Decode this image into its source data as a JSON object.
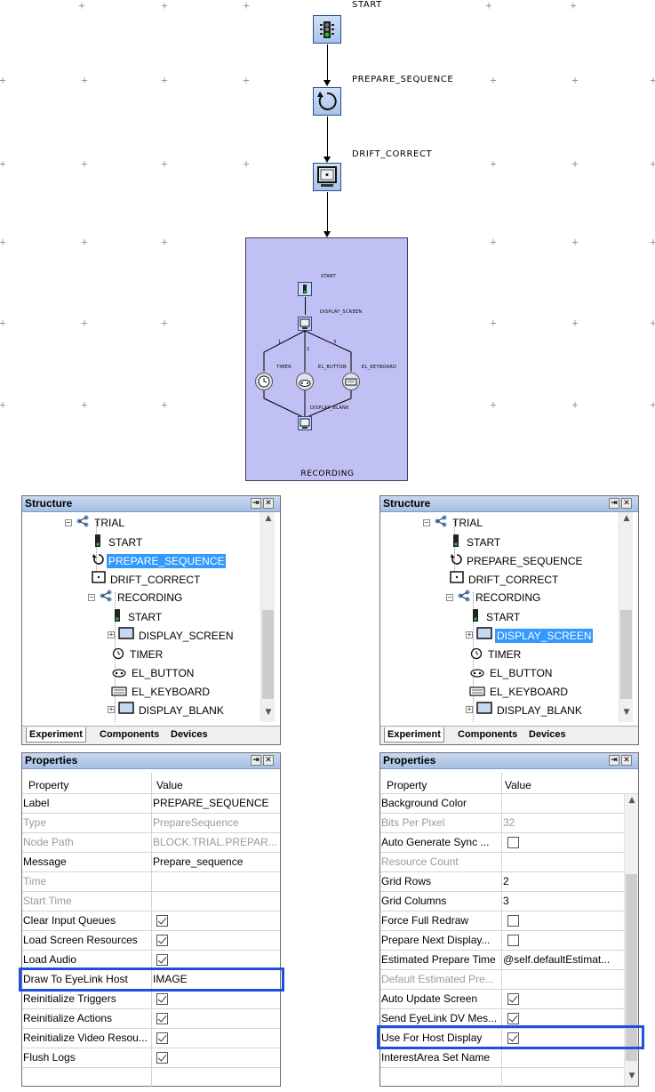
{
  "graph": {
    "nodes": {
      "start": "START",
      "prepare_sequence": "PREPARE_SEQUENCE",
      "drift_correct": "DRIFT_CORRECT",
      "recording": "RECORDING"
    },
    "recording_inner": {
      "start": "START",
      "display_screen": "DISPLAY_SCREEN",
      "timer": "TIMER",
      "el_button": "EL_BUTTON",
      "el_keyboard": "EL_KEYBOARD",
      "display_blank": "DISPLAY_BLANK",
      "branch_1": "1",
      "branch_2": "2",
      "branch_3": "3"
    }
  },
  "left": {
    "structure": {
      "title": "Structure",
      "items": [
        "TRIAL",
        "START",
        "PREPARE_SEQUENCE",
        "DRIFT_CORRECT",
        "RECORDING",
        "START",
        "DISPLAY_SCREEN",
        "TIMER",
        "EL_BUTTON",
        "EL_KEYBOARD",
        "DISPLAY_BLANK"
      ],
      "selected": "PREPARE_SEQUENCE",
      "tabs": [
        "Experiment",
        "Components",
        "Devices"
      ]
    },
    "properties": {
      "title": "Properties",
      "header": {
        "property": "Property",
        "value": "Value"
      },
      "rows": [
        {
          "label": "Label",
          "value": "PREPARE_SEQUENCE"
        },
        {
          "label": "Type",
          "value": "PrepareSequence"
        },
        {
          "label": "Node Path",
          "value": "BLOCK.TRIAL.PREPAR..."
        },
        {
          "label": "Message",
          "value": "Prepare_sequence"
        },
        {
          "label": "Time",
          "value": ""
        },
        {
          "label": "Start Time",
          "value": ""
        },
        {
          "label": "Clear Input Queues",
          "value": "checked"
        },
        {
          "label": "Load Screen Resources",
          "value": "checked"
        },
        {
          "label": "Load Audio",
          "value": "checked"
        },
        {
          "label": "Draw To EyeLink Host",
          "value": "IMAGE"
        },
        {
          "label": "Reinitialize Triggers",
          "value": "checked"
        },
        {
          "label": "Reinitialize Actions",
          "value": "checked"
        },
        {
          "label": "Reinitialize Video Resou...",
          "value": "checked"
        },
        {
          "label": "Flush Logs",
          "value": "checked"
        }
      ]
    }
  },
  "right": {
    "structure": {
      "title": "Structure",
      "items": [
        "TRIAL",
        "START",
        "PREPARE_SEQUENCE",
        "DRIFT_CORRECT",
        "RECORDING",
        "START",
        "DISPLAY_SCREEN",
        "TIMER",
        "EL_BUTTON",
        "EL_KEYBOARD",
        "DISPLAY_BLANK"
      ],
      "selected": "DISPLAY_SCREEN",
      "tabs": [
        "Experiment",
        "Components",
        "Devices"
      ]
    },
    "properties": {
      "title": "Properties",
      "header": {
        "property": "Property",
        "value": "Value"
      },
      "rows": [
        {
          "label": "Background Color",
          "value": ""
        },
        {
          "label": "Bits Per Pixel",
          "value": "32"
        },
        {
          "label": "Auto Generate Sync ...",
          "value": "unchecked"
        },
        {
          "label": "Resource Count",
          "value": ""
        },
        {
          "label": "Grid Rows",
          "value": "2"
        },
        {
          "label": "Grid Columns",
          "value": "3"
        },
        {
          "label": "Force Full Redraw",
          "value": "unchecked"
        },
        {
          "label": "Prepare Next Display...",
          "value": "unchecked"
        },
        {
          "label": "Estimated Prepare Time",
          "value": "@self.defaultEstimat..."
        },
        {
          "label": "Default Estimated Pre...",
          "value": ""
        },
        {
          "label": "Auto Update Screen",
          "value": "checked"
        },
        {
          "label": "Send EyeLink DV Mes...",
          "value": "checked"
        },
        {
          "label": "Use For Host Display",
          "value": "checked"
        },
        {
          "label": "InterestArea Set Name",
          "value": ""
        }
      ]
    }
  },
  "colors": {
    "selection": "#3399ff",
    "highlight_box": "#1f4fe0",
    "recording_fill": "#c0c0f4",
    "panel_header": "#b8cdea"
  },
  "icons": {
    "start": "traffic-light-icon",
    "prepare_sequence": "refresh-icon",
    "drift_correct": "monitor-icon",
    "recording": "sequence-icon",
    "timer": "clock-icon",
    "el_button": "gamepad-icon",
    "el_keyboard": "keyboard-icon"
  }
}
